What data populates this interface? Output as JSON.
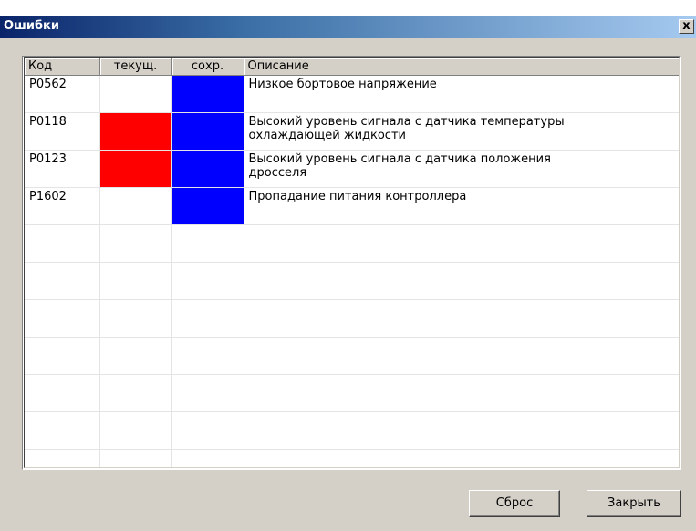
{
  "window": {
    "title": "Ошибки",
    "close_label": "x"
  },
  "columns": [
    "Код",
    "текущ.",
    "сохр.",
    "Описание"
  ],
  "rows": [
    {
      "code": "P0562",
      "current": false,
      "saved": true,
      "description": "Низкое бортовое напряжение"
    },
    {
      "code": "P0118",
      "current": true,
      "saved": true,
      "description": "Высокий уровень сигнала с датчика температуры охлаждающей жидкости"
    },
    {
      "code": "P0123",
      "current": true,
      "saved": true,
      "description": "Высокий уровень сигнала с датчика положения дросселя"
    },
    {
      "code": "P1602",
      "current": false,
      "saved": true,
      "description": "Пропадание питания контроллера"
    }
  ],
  "empty_rows": 7,
  "colors": {
    "current_active": "#ff0000",
    "saved_active": "#0000ff",
    "titlebar": "#0a246a",
    "window_bg": "#d4d0c8"
  },
  "buttons": {
    "reset_label": "Сброс",
    "close_label": "Закрыть"
  }
}
